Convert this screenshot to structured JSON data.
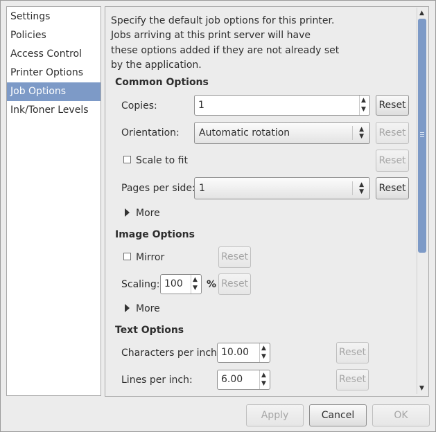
{
  "sidebar": {
    "items": [
      {
        "label": "Settings",
        "selected": false
      },
      {
        "label": "Policies",
        "selected": false
      },
      {
        "label": "Access Control",
        "selected": false
      },
      {
        "label": "Printer Options",
        "selected": false
      },
      {
        "label": "Job Options",
        "selected": true
      },
      {
        "label": "Ink/Toner Levels",
        "selected": false
      }
    ]
  },
  "main": {
    "description": "Specify the default job options for this printer. Jobs arriving at this print server will have these options added if they are not already set by the application.",
    "common": {
      "title": "Common Options",
      "copies_label": "Copies:",
      "copies_value": "1",
      "orientation_label": "Orientation:",
      "orientation_value": "Automatic rotation",
      "scale_label": "Scale to fit",
      "scale_checked": false,
      "pages_label": "Pages per side:",
      "pages_value": "1",
      "more_label": "More"
    },
    "image": {
      "title": "Image Options",
      "mirror_label": "Mirror",
      "mirror_checked": false,
      "scaling_label": "Scaling:",
      "scaling_value": "100",
      "scaling_unit": "%",
      "more_label": "More"
    },
    "text": {
      "title": "Text Options",
      "cpi_label": "Characters per inch:",
      "cpi_value": "10.00",
      "lpi_label": "Lines per inch:",
      "lpi_value": "6.00"
    },
    "reset_label": "Reset"
  },
  "buttons": {
    "apply": "Apply",
    "cancel": "Cancel",
    "ok": "OK"
  },
  "colors": {
    "selection": "#7d9ac7",
    "background": "#ececec"
  }
}
